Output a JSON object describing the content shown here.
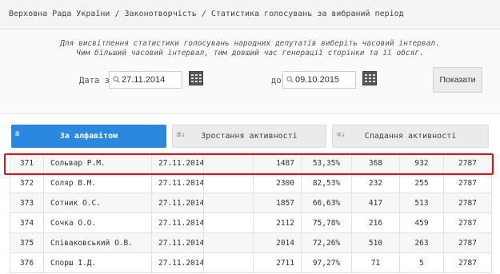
{
  "breadcrumb": {
    "text": "Верховна Рада України / Законотворчість / Статистика голосувань за вибраний період"
  },
  "filter": {
    "hint_line1": "Для висвітлення статистики голосувань народних депутатів виберіть часовий інтервал.",
    "hint_line2": "Чим більший часовий інтервал, тим довший час генерації сторінки та її обсяг.",
    "date_from_label": "Дата з",
    "date_from_value": "27.11.2014",
    "date_to_label": "до",
    "date_to_value": "09.10.2015",
    "show_button": "Показати"
  },
  "tabs": [
    {
      "label": "За алфавітом",
      "active": true,
      "icon": "sort-alpha-icon"
    },
    {
      "label": "Зростання активності",
      "active": false,
      "icon": "sort-asc-icon"
    },
    {
      "label": "Спадання активності",
      "active": false,
      "icon": "sort-desc-icon"
    }
  ],
  "rows": [
    {
      "num": "371",
      "name": "Сольвар Р.М.",
      "date": "27.11.2014",
      "c1": "",
      "c2": "1487",
      "c3": "53,35%",
      "c4": "368",
      "c5": "932",
      "c6": "2787"
    },
    {
      "num": "372",
      "name": "Соляр В.М.",
      "date": "27.11.2014",
      "c1": "",
      "c2": "2300",
      "c3": "82,53%",
      "c4": "232",
      "c5": "255",
      "c6": "2787"
    },
    {
      "num": "373",
      "name": "Сотник О.С.",
      "date": "27.11.2014",
      "c1": "",
      "c2": "1857",
      "c3": "66,63%",
      "c4": "417",
      "c5": "513",
      "c6": "2787"
    },
    {
      "num": "374",
      "name": "Сочка О.О.",
      "date": "27.11.2014",
      "c1": "",
      "c2": "2112",
      "c3": "75,78%",
      "c4": "216",
      "c5": "459",
      "c6": "2787"
    },
    {
      "num": "375",
      "name": "Співаковський О.В.",
      "date": "27.11.2014",
      "c1": "",
      "c2": "2014",
      "c3": "72,26%",
      "c4": "510",
      "c5": "263",
      "c6": "2787"
    },
    {
      "num": "376",
      "name": "Спорш І.Д.",
      "date": "27.11.2014",
      "c1": "",
      "c2": "2711",
      "c3": "97,27%",
      "c4": "71",
      "c5": "5",
      "c6": "2787"
    }
  ],
  "colors": {
    "accent": "#2a89df",
    "highlight": "#e0121b"
  }
}
